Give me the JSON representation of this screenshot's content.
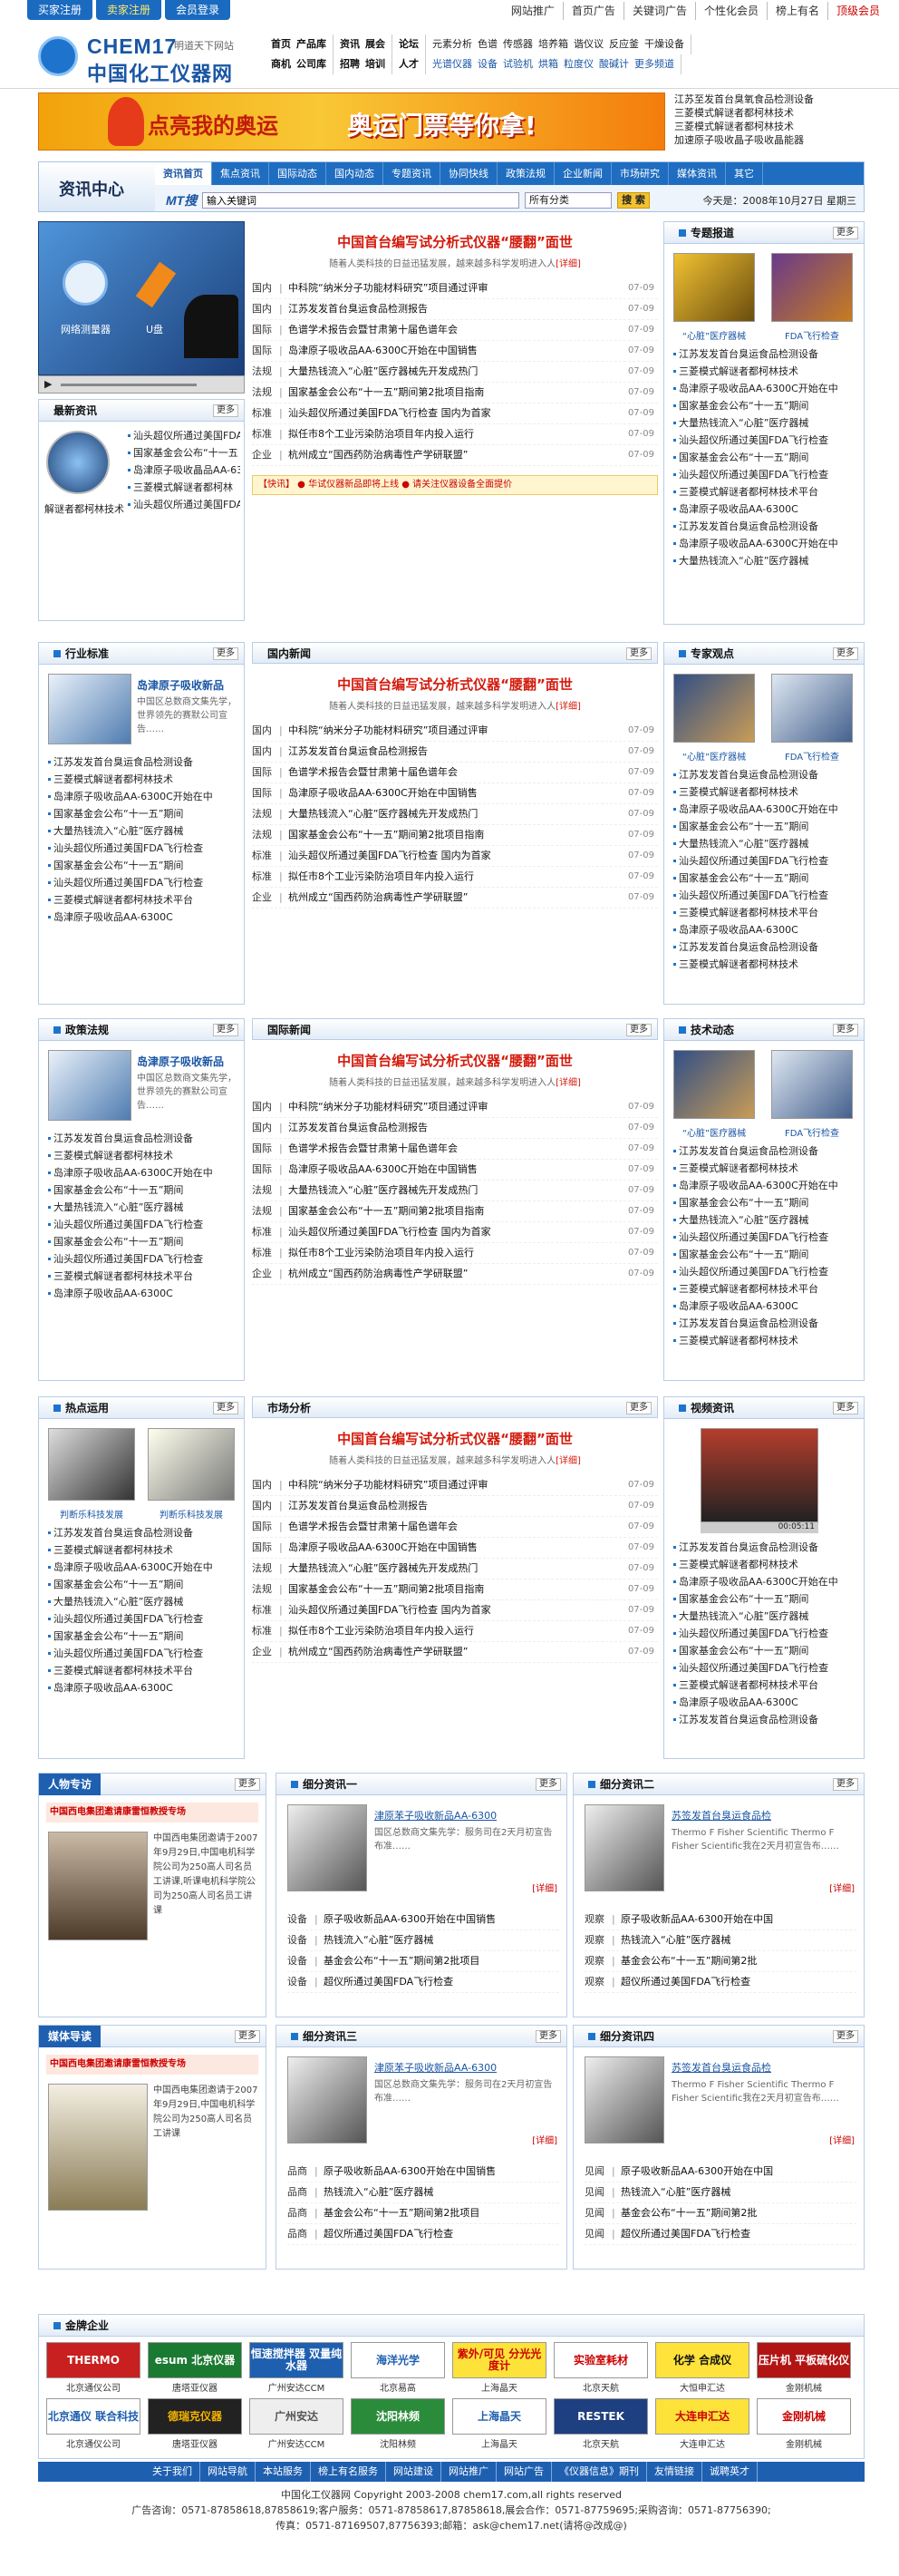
{
  "top_tabs": [
    "买家注册",
    "卖家注册",
    "会员登录"
  ],
  "top_links": [
    "网站推广",
    "首页广告",
    "关键词广告",
    "个性化会员",
    "榜上有名",
    "顶级会员"
  ],
  "logo": {
    "en": "CHEM17",
    "tag": "明道天下网站",
    "cn": "中国化工仪器网"
  },
  "cat_nav": {
    "row1": [
      [
        "首页",
        "产品库"
      ],
      [
        "资讯",
        "展会"
      ],
      [
        "论坛"
      ],
      [
        "元素分析",
        "色谱",
        "传感器",
        "培养箱",
        "谐仪议",
        "反应釜",
        "干燥设备"
      ]
    ],
    "row2": [
      [
        "商机",
        "公司库"
      ],
      [
        "招聘",
        "培训"
      ],
      [
        "人才"
      ],
      [
        "光谱仪器",
        "设备",
        "试验机",
        "烘箱",
        "粒度仪",
        "酸碱计",
        "更多频道"
      ]
    ]
  },
  "banner": {
    "t1": "点亮我的奥运",
    "t2": "奥运门票等你拿!"
  },
  "banner_links": [
    "江苏至发首台臭氧食品检测设备",
    "三菱模式解谜者都柯林技术",
    "三菱模式解谜者都柯林技术",
    "加速原子吸收晶子吸收晶能器"
  ],
  "news_head": {
    "title": "资讯中心",
    "tabs": [
      "资讯首页",
      "焦点资讯",
      "国际动态",
      "国内动态",
      "专题资讯",
      "协同快线",
      "政策法规",
      "企业新闻",
      "市场研究",
      "媒体资讯",
      "其它"
    ],
    "mt": "MT搜",
    "search_value": "输入关键词",
    "select_value": "所有分类",
    "search_btn": "搜 索",
    "date": "今天是：2008年10月27日 星期三"
  },
  "headline": "中国首台编写试分析式仪器“腰翻”面世",
  "headline_sub": "随着人类科技的日益迅猛发展，越来越多科学发明进入人",
  "detail": "[详细]",
  "news_rows": [
    {
      "cat": "国内",
      "title": "中科院“纳米分子功能材料研究”项目通过评审",
      "date": "07-09"
    },
    {
      "cat": "国内",
      "title": "江苏发发首台臭运食品检测报告",
      "date": "07-09"
    },
    {
      "cat": "国际",
      "title": "色谱学术报告会暨甘肃第十届色谱年会",
      "date": "07-09"
    },
    {
      "cat": "国际",
      "title": "岛津原子吸收品AA-6300C开始在中国销售",
      "date": "07-09"
    },
    {
      "cat": "法规",
      "title": "大量热钱流入“心脏”医疗器械先开发成热门",
      "date": "07-09"
    },
    {
      "cat": "法规",
      "title": "国家基金会公布“十一五”期间第2批项目指南",
      "date": "07-09"
    },
    {
      "cat": "标准",
      "title": "汕头超仪所通过美国FDA飞行检查 国内为首家",
      "date": "07-09"
    },
    {
      "cat": "标准",
      "title": "拟任市8个工业污染防治项目年内投入运行",
      "date": "07-09"
    },
    {
      "cat": "企业",
      "title": "杭州成立“国西药防治病毒性产学研联盟”",
      "date": "07-09"
    }
  ],
  "ticker": "【快讯】 ● 华试仪器新品即将上线 ● 请关注仪器设备全面提价",
  "special": {
    "title": "专题报道",
    "more": "更多",
    "captions": [
      "“心脏”医疗器械",
      "FDA飞行检查"
    ]
  },
  "side_list": [
    "江苏发发首台臭运食品检测设备",
    "三菱模式解谜者都柯林技术",
    "岛津原子吸收品AA-6300C开始在中",
    "国家基金会公布“十一五”期间",
    "大量热钱流入“心脏”医疗器械",
    "汕头超仪所通过美国FDA飞行检查",
    "国家基金会公布“十一五”期间",
    "汕头超仪所通过美国FDA飞行检查",
    "三菱模式解谜者都柯林技术平台",
    "岛津原子吸收品AA-6300C"
  ],
  "video_player": {
    "left": "网络测量器",
    "right": "U盘",
    "time": "00:05:11"
  },
  "new_info": {
    "title": "最新资讯",
    "more": "更多",
    "items": [
      "汕头超仪所通过美国FDA",
      "国家基金会公布“十一五",
      "岛津原子吸收晶品AA-63",
      "三菱模式解谜者都柯林",
      "汕头超仪所通过美国FDA"
    ],
    "left": "解谜者都柯林技术"
  },
  "sections": [
    {
      "left_title": "行业标准",
      "mid_title": "国内新闻",
      "right_title": "专家观点",
      "prod": "岛津原子吸收新品",
      "prod_desc": "中国区总数商文集先学，世界领先的赛默公司宣告……",
      "right_caps": [
        "“心脏”医疗器械",
        "FDA飞行检查"
      ]
    },
    {
      "left_title": "政策法规",
      "mid_title": "国际新闻",
      "right_title": "技术动态",
      "prod": "岛津原子吸收新品",
      "prod_desc": "中国区总数商文集先学，世界领先的赛默公司宣告……",
      "right_caps": [
        "“心脏”医疗器械",
        "FDA飞行检查"
      ]
    },
    {
      "left_title": "热点运用",
      "mid_title": "市场分析",
      "right_title": "视频资讯",
      "prod": "",
      "prod_desc": "",
      "right_caps": []
    }
  ],
  "hot_caps": [
    "判断乐科技发展",
    "判断乐科技发展"
  ],
  "more": "更多",
  "people": {
    "title": "人物专访",
    "head": "中国西电集团邀请康雷恒教授专场",
    "text": "中国西电集团邀请于2007年9月29日,中国电机科学院公司为250高人司名员工讲课,听课电机科学院公司为250高人司名员工讲课"
  },
  "media": {
    "title": "媒体导读",
    "head": "中国西电集团邀请康雷恒教授专场",
    "text": "中国西电集团邀请于2007年9月29日,中国电机科学院公司为250高人司名员工讲课"
  },
  "sub_info": [
    {
      "title": "细分资讯一",
      "head": "津原苯子吸收新品AA-6300",
      "desc": "国区总数商文集先学：服务司在2天月初宣告布准……",
      "rows": [
        [
          "设备",
          "原子吸收新品AA-6300开始在中国销售"
        ],
        [
          "设备",
          "热钱流入“心脏”医疗器械"
        ],
        [
          "设备",
          "基金会公布“十一五”期间第2批项目"
        ],
        [
          "设备",
          "超仪所通过美国FDA飞行检查"
        ]
      ]
    },
    {
      "title": "细分资讯二",
      "head": "苏签发首台臭运食品检",
      "desc": "Thermo F Fisher Scientific Thermo F Fisher Scientific我在2天月初宣告布……",
      "rows": [
        [
          "观察",
          "原子吸收新品AA-6300开始在中国"
        ],
        [
          "观察",
          "热钱流入“心脏”医疗器械"
        ],
        [
          "观察",
          "基金会公布“十一五”期间第2批"
        ],
        [
          "观察",
          "超仪所通过美国FDA飞行检查"
        ]
      ]
    },
    {
      "title": "细分资讯三",
      "head": "津原苯子吸收新品AA-6300",
      "desc": "国区总数商文集先学：服务司在2天月初宣告布准……",
      "rows": [
        [
          "品商",
          "原子吸收新品AA-6300开始在中国销售"
        ],
        [
          "品商",
          "热钱流入“心脏”医疗器械"
        ],
        [
          "品商",
          "基金会公布“十一五”期间第2批项目"
        ],
        [
          "品商",
          "超仪所通过美国FDA飞行检查"
        ]
      ]
    },
    {
      "title": "细分资讯四",
      "head": "苏签发首台臭运食品检",
      "desc": "Thermo F Fisher Scientific Thermo F Fisher Scientific我在2天月初宣告布……",
      "rows": [
        [
          "见闻",
          "原子吸收新品AA-6300开始在中国"
        ],
        [
          "见闻",
          "热钱流入“心脏”医疗器械"
        ],
        [
          "见闻",
          "基金会公布“十一五”期间第2批"
        ],
        [
          "见闻",
          "超仪所通过美国FDA飞行检查"
        ]
      ]
    }
  ],
  "gold": {
    "title": "金牌企业",
    "logos": [
      {
        "t": "THERMO",
        "c": "北京通仪公司",
        "bg": "#c82020",
        "fg": "#fff"
      },
      {
        "t": "esum 北京仪器",
        "c": "唐塔亚仪器",
        "bg": "#1b7a31",
        "fg": "#fff"
      },
      {
        "t": "恒速搅拌器 双量纯水器",
        "c": "广州安达CCM",
        "bg": "#1e5fb0",
        "fg": "#fff"
      },
      {
        "t": "海洋光学",
        "c": "北京易高",
        "bg": "#fff",
        "fg": "#1e5fb0"
      },
      {
        "t": "紫外/可见 分光光度计",
        "c": "上海晶天",
        "bg": "#fde23a",
        "fg": "#c00"
      },
      {
        "t": "实验室耗材",
        "c": "北京天航",
        "bg": "#fff",
        "fg": "#c00"
      },
      {
        "t": "化学 合成仪",
        "c": "大恒申汇达",
        "bg": "#ffe23a",
        "fg": "#111"
      },
      {
        "t": "压片机 平板硫化仪",
        "c": "金刚机械",
        "bg": "#b21414",
        "fg": "#fff"
      },
      {
        "t": "北京通仪 联合科技",
        "c": "北京通仪公司",
        "bg": "#fff",
        "fg": "#1e5fb0"
      },
      {
        "t": "德瑞克仪器",
        "c": "唐塔亚仪器",
        "bg": "#222",
        "fg": "#f7b500"
      },
      {
        "t": "广州安达",
        "c": "广州安达CCM",
        "bg": "#eee",
        "fg": "#555"
      },
      {
        "t": "沈阳林频",
        "c": "沈阳林频",
        "bg": "#2a8c3a",
        "fg": "#fff"
      },
      {
        "t": "上海晶天",
        "c": "上海晶天",
        "bg": "#fff",
        "fg": "#1e5fb0"
      },
      {
        "t": "RESTEK",
        "c": "北京天航",
        "bg": "#1e3f80",
        "fg": "#fff"
      },
      {
        "t": "大连申汇达",
        "c": "大连申汇达",
        "bg": "#fde23a",
        "fg": "#c00"
      },
      {
        "t": "金刚机械",
        "c": "金刚机械",
        "bg": "#fff",
        "fg": "#c00"
      }
    ]
  },
  "bottom_links": [
    "关于我们",
    "网站导航",
    "本站服务",
    "榜上有名服务",
    "网站建设",
    "网站推广",
    "网站广告",
    "《仪器信息》期刊",
    "友情链接",
    "诚聘英才"
  ],
  "footer": [
    "中国化工仪器网  Copyright  2003-2008  chem17.com,all  rights  reserved",
    "广告咨询：0571-87858618,87858619;客户服务：0571-87858617,87858618,展会合作：0571-87759695;采购咨询：0571-87756390;",
    "传真：0571-87169507,87756393;邮箱：ask@chem17.net(请将@改成@)"
  ]
}
